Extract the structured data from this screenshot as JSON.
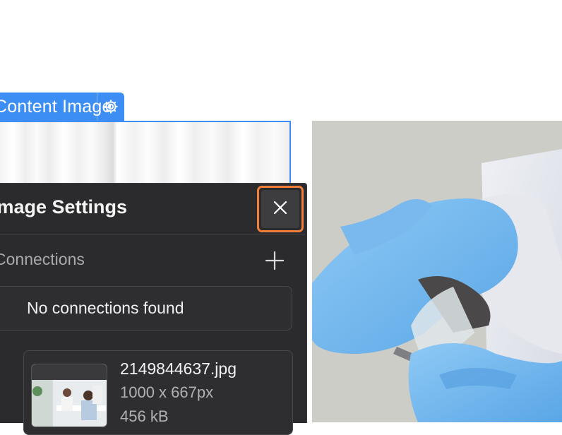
{
  "element_tag": {
    "label": "Content Image",
    "settings_icon": "gear-icon"
  },
  "panel": {
    "title": "Image Settings",
    "close_icon": "close-icon",
    "section": {
      "title": "Connections",
      "add_icon": "plus-icon",
      "empty_message": "No connections found"
    },
    "file": {
      "name": "2149844637.jpg",
      "dimensions": "1000 x 667px",
      "size": "456 kB"
    }
  },
  "colors": {
    "accent": "#3d8ef4",
    "highlight": "#f07f3c",
    "panel_bg": "#2b2b2d"
  }
}
